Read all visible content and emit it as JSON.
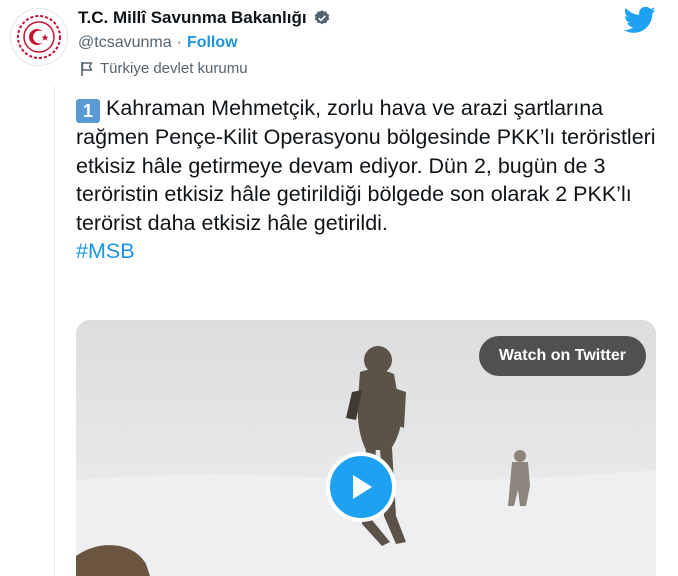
{
  "account": {
    "name": "T.C. Millî Savunma Bakanlığı",
    "handle": "@tcsavunma",
    "separator": "·",
    "follow_label": "Follow",
    "label": "Türkiye devlet kurumu"
  },
  "tweet": {
    "badge": "1",
    "text": "Kahraman Mehmetçik, zorlu hava ve arazi şartlarına rağmen Pençe-Kilit Operasyonu bölgesinde PKK’lı teröristleri etkisiz hâle getirmeye devam ediyor. Dün 2, bugün de 3 teröristin etkisiz hâle getirildiği bölgede son olarak 2 PKK’lı terörist daha etkisiz hâle getirildi.",
    "hashtag": "#MSB"
  },
  "media": {
    "watch_label": "Watch on Twitter"
  },
  "colors": {
    "accent": "#1b95e0",
    "twitter_blue": "#1da1f2",
    "text": "#0f1419",
    "muted": "#536471"
  }
}
